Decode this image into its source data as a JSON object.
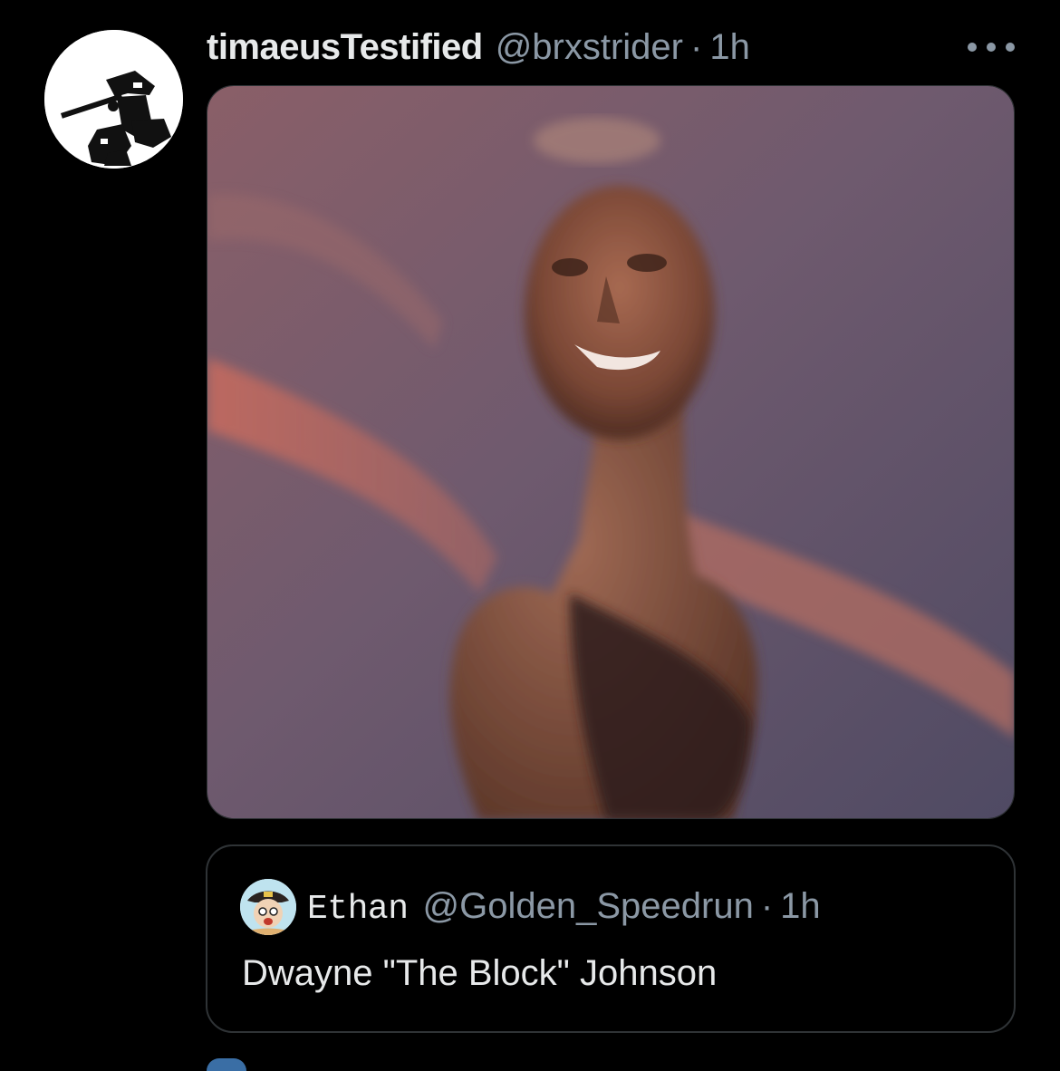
{
  "tweet": {
    "display_name": "timaeusTestified",
    "handle": "@brxstrider",
    "separator": "·",
    "time": "1h",
    "avatar_icon": "profile-avatar",
    "more_icon": "more-horizontal-icon",
    "media_alt": "photo"
  },
  "quote": {
    "display_name": "Ethan",
    "handle": "@Golden_Speedrun",
    "separator": "·",
    "time": "1h",
    "text": "Dwayne \"The Block\" Johnson",
    "avatar_icon": "profile-avatar"
  },
  "colors": {
    "background": "#000000",
    "primary_text": "#e7e9ea",
    "secondary_text": "#8b98a5",
    "border": "#2f3336"
  }
}
